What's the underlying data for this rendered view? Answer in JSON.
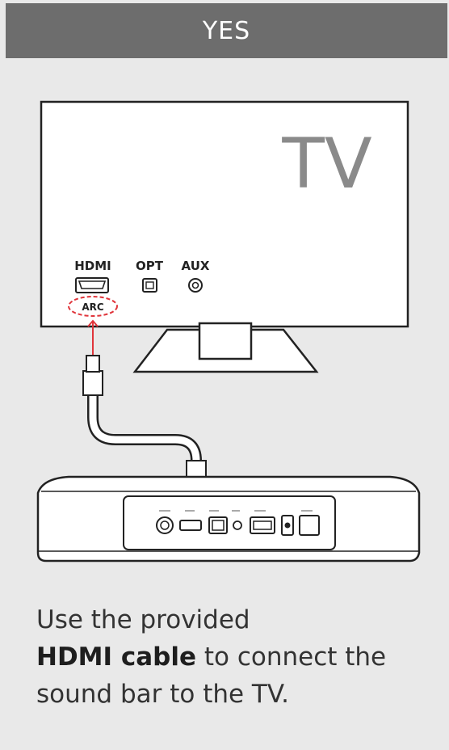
{
  "header": {
    "label": "YES"
  },
  "tv": {
    "label": "TV",
    "ports": {
      "hdmi": "HDMI",
      "opt": "OPT",
      "aux": "AUX",
      "arc": "ARC"
    }
  },
  "caption": {
    "line1": "Use the provided",
    "bold": "HDMI cable",
    "rest": " to connect the",
    "line3": "sound bar to the TV."
  },
  "colors": {
    "header_bg": "#6d6d6d",
    "background": "#e9e9e9",
    "accent": "#e0353b",
    "outline": "#222222"
  }
}
